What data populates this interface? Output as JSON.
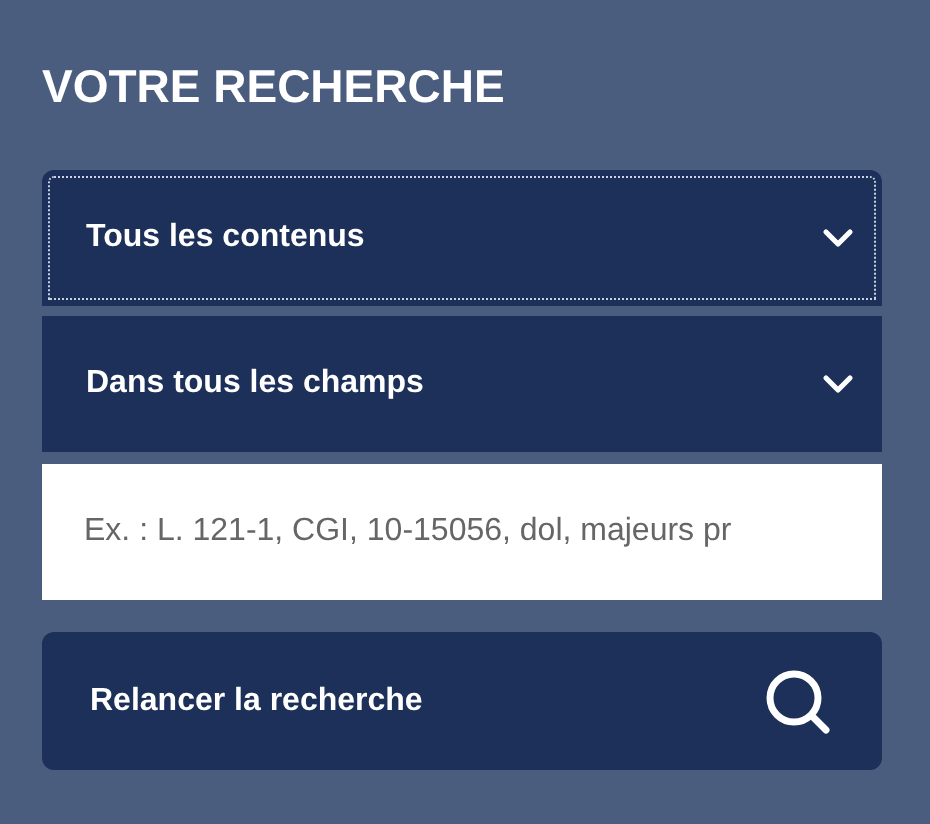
{
  "heading": "VOTRE RECHERCHE",
  "dropdowns": [
    {
      "value": "Tous les contenus",
      "focused": true
    },
    {
      "value": "Dans tous les champs",
      "focused": false
    }
  ],
  "search": {
    "placeholder": "Ex. : L. 121-1, CGI, 10-15056, dol, majeurs pr"
  },
  "button": {
    "label": "Relancer la recherche"
  }
}
